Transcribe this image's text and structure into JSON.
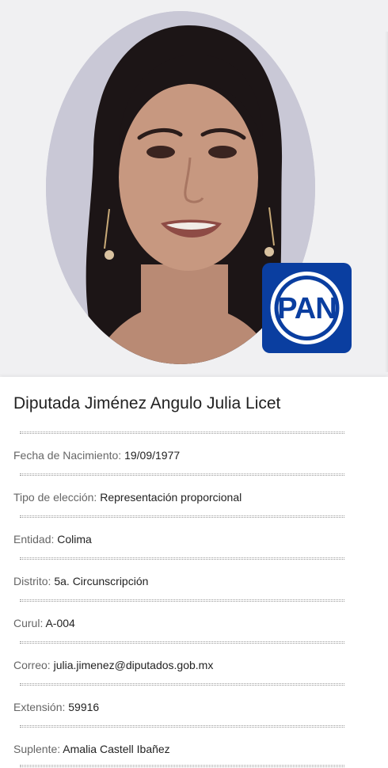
{
  "header": {
    "party_logo_text": "PAN",
    "party_logo_color": "#0a3ea0"
  },
  "profile": {
    "title": "Diputada Jiménez Angulo Julia Licet",
    "fields": [
      {
        "label": "Fecha de Nacimiento: ",
        "value": "19/09/1977"
      },
      {
        "label": "Tipo de elección: ",
        "value": "Representación proporcional"
      },
      {
        "label": "Entidad: ",
        "value": "Colima"
      },
      {
        "label": "Distrito: ",
        "value": "5a. Circunscripción"
      },
      {
        "label": "Curul: ",
        "value": "A-004"
      },
      {
        "label": "Correo: ",
        "value": "julia.jimenez@diputados.gob.mx"
      },
      {
        "label": "Extensión: ",
        "value": "59916"
      },
      {
        "label": "Suplente: ",
        "value": "Amalia Castell Ibañez"
      }
    ]
  }
}
